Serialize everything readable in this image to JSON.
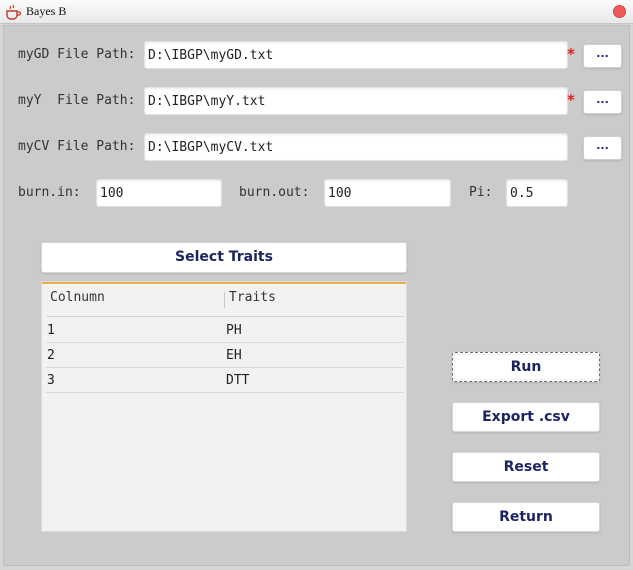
{
  "window": {
    "title": "Bayes B",
    "icon": "java-cup-icon",
    "close_color": "#ee5b5b"
  },
  "files": [
    {
      "label": "myGD File Path:",
      "value": "D:\\IBGP\\myGD.txt",
      "required": true,
      "browse_label": "..."
    },
    {
      "label": "myY  File Path:",
      "value": "D:\\IBGP\\myY.txt",
      "required": true,
      "browse_label": "..."
    },
    {
      "label": "myCV File Path:",
      "value": "D:\\IBGP\\myCV.txt",
      "required": false,
      "browse_label": "..."
    }
  ],
  "required_mark": "*",
  "params": {
    "burn_in": {
      "label": "burn.in:",
      "value": "100"
    },
    "burn_out": {
      "label": "burn.out:",
      "value": "100"
    },
    "pi": {
      "label": "Pi:",
      "value": "0.5"
    }
  },
  "select_traits_label": "Select Traits",
  "table": {
    "columns": [
      "Colnumn",
      "Traits"
    ],
    "rows": [
      [
        "1",
        "PH"
      ],
      [
        "2",
        "EH"
      ],
      [
        "3",
        "DTT"
      ]
    ]
  },
  "actions": {
    "run": "Run",
    "export": "Export .csv",
    "reset": "Reset",
    "return": "Return"
  },
  "colors": {
    "accent_line": "#e9b04f",
    "button_text": "#1b2562",
    "required": "#e02020"
  }
}
